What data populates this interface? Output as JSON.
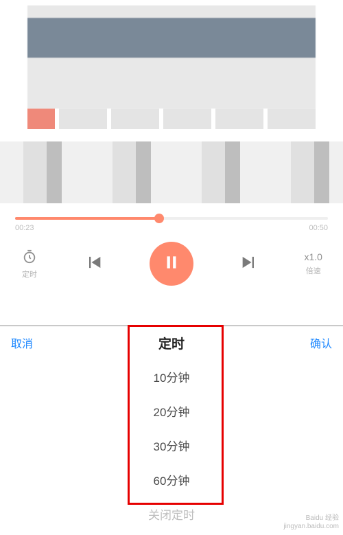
{
  "player": {
    "elapsed": "00:23",
    "duration": "00:50",
    "progress_percent": 46,
    "timer_label": "定时",
    "speed_value": "x1.0",
    "speed_label": "倍速"
  },
  "sheet": {
    "title": "定时",
    "cancel_label": "取消",
    "confirm_label": "确认",
    "options": [
      "10分钟",
      "20分钟",
      "30分钟",
      "60分钟"
    ],
    "close_label": "关闭定时"
  },
  "watermark": {
    "line1": "Baidu 经验",
    "line2": "jingyan.baidu.com"
  },
  "colors": {
    "accent": "#ff4b1f",
    "link": "#1e88ff",
    "highlight_box": "#e60000"
  }
}
